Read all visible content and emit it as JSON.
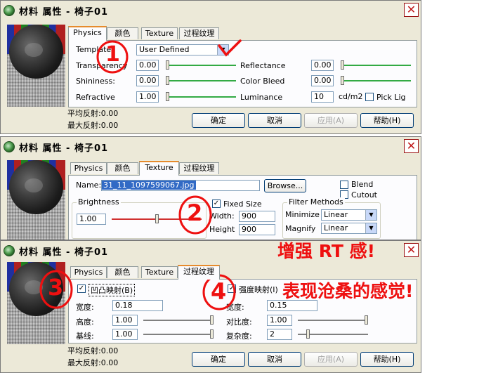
{
  "colors": {
    "annotation": "#ee1010",
    "slider_green": "#33aa44",
    "slider_red": "#d03030",
    "tab_highlight": "#e68b2c",
    "selection": "#316ac5"
  },
  "dialog1": {
    "title": "材料  属性 - 椅子01",
    "close_icon": "close-icon",
    "tabs": [
      "Physics",
      "颜色",
      "Texture",
      "过程纹理"
    ],
    "template_label": "Template",
    "template_value": "User Defined",
    "transparency_label": "Transparency",
    "transparency_value": "0.00",
    "reflectance_label": "Reflectance",
    "reflectance_value": "0.00",
    "shininess_label": "Shininess:",
    "shininess_value": "0.00",
    "colorbleed_label": "Color Bleed",
    "colorbleed_value": "0.00",
    "refractive_label": "Refractive",
    "refractive_value": "1.00",
    "luminance_label": "Luminance",
    "luminance_value": "10",
    "luminance_unit": "cd/m2",
    "picklig_label": "Pick Lig",
    "avg_reflect": "平均反射:0.00",
    "max_reflect": "最大反射:0.00",
    "ok": "确定",
    "cancel": "取消",
    "apply": "应用(A)",
    "help": "帮助(H)",
    "annotation_number": "1"
  },
  "dialog2": {
    "title": "材料  属性 - 椅子01",
    "tabs": [
      "Physics",
      "颜色",
      "Texture",
      "过程纹理"
    ],
    "name_label": "Name:",
    "name_value": "31_11_1097599067.jpg",
    "browse": "Browse...",
    "blend": "Blend",
    "cutout": "Cutout",
    "brightness_label": "Brightness",
    "brightness_value": "1.00",
    "fixed_size": "Fixed Size",
    "width_label": "Width:",
    "width_value": "900",
    "height_label": "Height",
    "height_value": "900",
    "filter_label": "Filter Methods",
    "minimize_label": "Minimize",
    "minimize_value": "Linear",
    "magnify_label": "Magnify",
    "magnify_value": "Linear",
    "annotation_number": "2"
  },
  "dialog3": {
    "title": "材料  属性 - 椅子01",
    "tabs": [
      "Physics",
      "颜色",
      "Texture",
      "过程纹理"
    ],
    "bump_label": "凹凸映射(B)",
    "bump_width_label": "宽度:",
    "bump_width_value": "0.18",
    "height_label": "高度:",
    "height_value": "1.00",
    "baseline_label": "基线:",
    "baseline_value": "1.00",
    "intensity_label": "强度映射(I)",
    "int_width_label": "宽度:",
    "int_width_value": "0.15",
    "contrast_label": "对比度:",
    "contrast_value": "1.00",
    "complexity_label": "复杂度:",
    "complexity_value": "2",
    "avg_reflect": "平均反射:0.00",
    "max_reflect": "最大反射:0.00",
    "ok": "确定",
    "cancel": "取消",
    "apply": "应用(A)",
    "help": "帮助(H)",
    "annotation_number_3": "3",
    "annotation_number_4": "4"
  },
  "annotations": {
    "rt_text": "增强 RT 感!",
    "desc_text": "表现沧桑的感觉!"
  }
}
